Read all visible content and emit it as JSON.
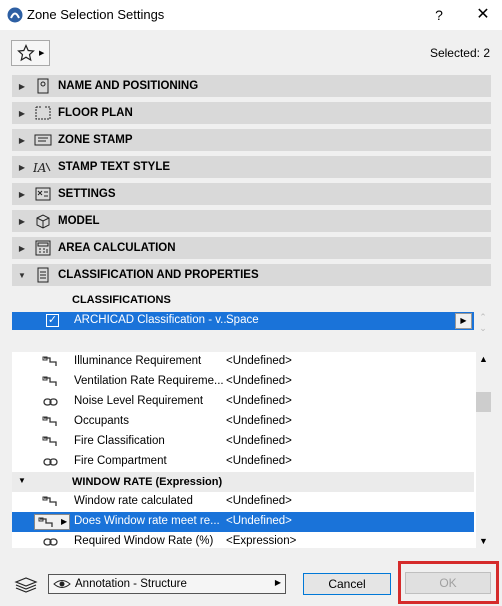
{
  "window": {
    "title": "Zone Selection Settings",
    "help_label": "?",
    "close_label": "✕"
  },
  "toolbar": {
    "selected_text": "Selected: 2"
  },
  "panels": [
    {
      "label": "NAME AND POSITIONING",
      "expanded": false
    },
    {
      "label": "FLOOR PLAN",
      "expanded": false
    },
    {
      "label": "ZONE STAMP",
      "expanded": false
    },
    {
      "label": "STAMP TEXT STYLE",
      "expanded": false
    },
    {
      "label": "SETTINGS",
      "expanded": false
    },
    {
      "label": "MODEL",
      "expanded": false
    },
    {
      "label": "AREA CALCULATION",
      "expanded": false
    },
    {
      "label": "CLASSIFICATION AND PROPERTIES",
      "expanded": true
    }
  ],
  "classifications": {
    "header": "CLASSIFICATIONS",
    "row": {
      "name": "ARCHICAD Classification - v...",
      "value": "Space",
      "checked": true
    }
  },
  "properties": [
    {
      "name": "Illuminance Requirement",
      "value": "<Undefined>",
      "icon": "link-icon"
    },
    {
      "name": "Ventilation Rate Requireme...",
      "value": "<Undefined>",
      "icon": "link-icon"
    },
    {
      "name": "Noise Level Requirement",
      "value": "<Undefined>",
      "icon": "chain-icon"
    },
    {
      "name": "Occupants",
      "value": "<Undefined>",
      "icon": "link-icon"
    },
    {
      "name": "Fire Classification",
      "value": "<Undefined>",
      "icon": "link-icon"
    },
    {
      "name": "Fire Compartment",
      "value": "<Undefined>",
      "icon": "chain-icon"
    }
  ],
  "group": {
    "label": "WINDOW RATE (Expression)"
  },
  "group_properties": [
    {
      "name": "Window rate calculated",
      "value": "<Undefined>",
      "icon": "link-icon",
      "selected": false
    },
    {
      "name": "Does Window rate meet re...",
      "value": "<Undefined>",
      "icon": "link-icon",
      "selected": true
    },
    {
      "name": "Required Window Rate (%)",
      "value": "<Expression>",
      "icon": "chain-icon",
      "selected": false
    }
  ],
  "footer": {
    "layer_value": "Annotation - Structure",
    "cancel_label": "Cancel",
    "ok_label": "OK"
  },
  "colors": {
    "selection": "#1a73d9",
    "highlight_frame": "#d52b2b",
    "panel_bg": "#d9d9d9"
  }
}
